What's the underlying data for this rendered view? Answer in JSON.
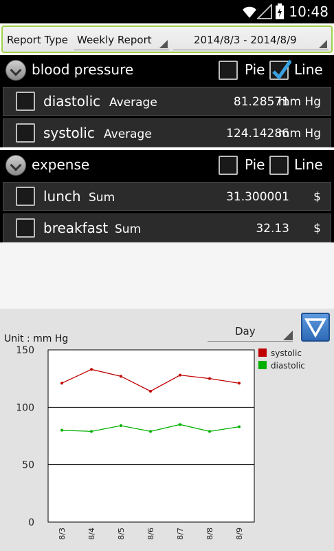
{
  "status_bar": {
    "time": "10:48",
    "icons": [
      "wifi-icon",
      "signal-icon",
      "battery-charging-icon"
    ]
  },
  "report_bar": {
    "label": "Report Type",
    "report_type": "Weekly Report",
    "date_range": "2014/8/3 - 2014/8/9"
  },
  "sections": [
    {
      "title": "blood pressure",
      "pie_label": "Pie",
      "line_label": "Line",
      "pie_checked": false,
      "line_checked": true,
      "rows": [
        {
          "name": "diastolic",
          "aggregate": "Average",
          "value": "81.28571",
          "unit": "mm Hg"
        },
        {
          "name": "systolic",
          "aggregate": "Average",
          "value": "124.14286",
          "unit": "mm Hg"
        }
      ]
    },
    {
      "title": "expense",
      "pie_label": "Pie",
      "line_label": "Line",
      "pie_checked": false,
      "line_checked": false,
      "rows": [
        {
          "name": "lunch",
          "aggregate": "Sum",
          "value": "31.300001",
          "unit": "$"
        },
        {
          "name": "breakfast",
          "aggregate": "Sum",
          "value": "32.13",
          "unit": "$"
        }
      ]
    }
  ],
  "chart_panel": {
    "period": "Day",
    "unit_label": "Unit : mm Hg"
  },
  "chart_data": {
    "type": "line",
    "x": [
      "8/3",
      "8/4",
      "8/5",
      "8/6",
      "8/7",
      "8/8",
      "8/9"
    ],
    "ylim": [
      0,
      150
    ],
    "yticks": [
      0,
      50,
      100,
      150
    ],
    "series": [
      {
        "name": "systolic",
        "color": "#c00000",
        "values": [
          121,
          133,
          127,
          114,
          128,
          125,
          121
        ]
      },
      {
        "name": "diastolic",
        "color": "#00b000",
        "values": [
          80,
          79,
          84,
          79,
          85,
          79,
          83
        ]
      }
    ],
    "legend_position": "top-right"
  }
}
